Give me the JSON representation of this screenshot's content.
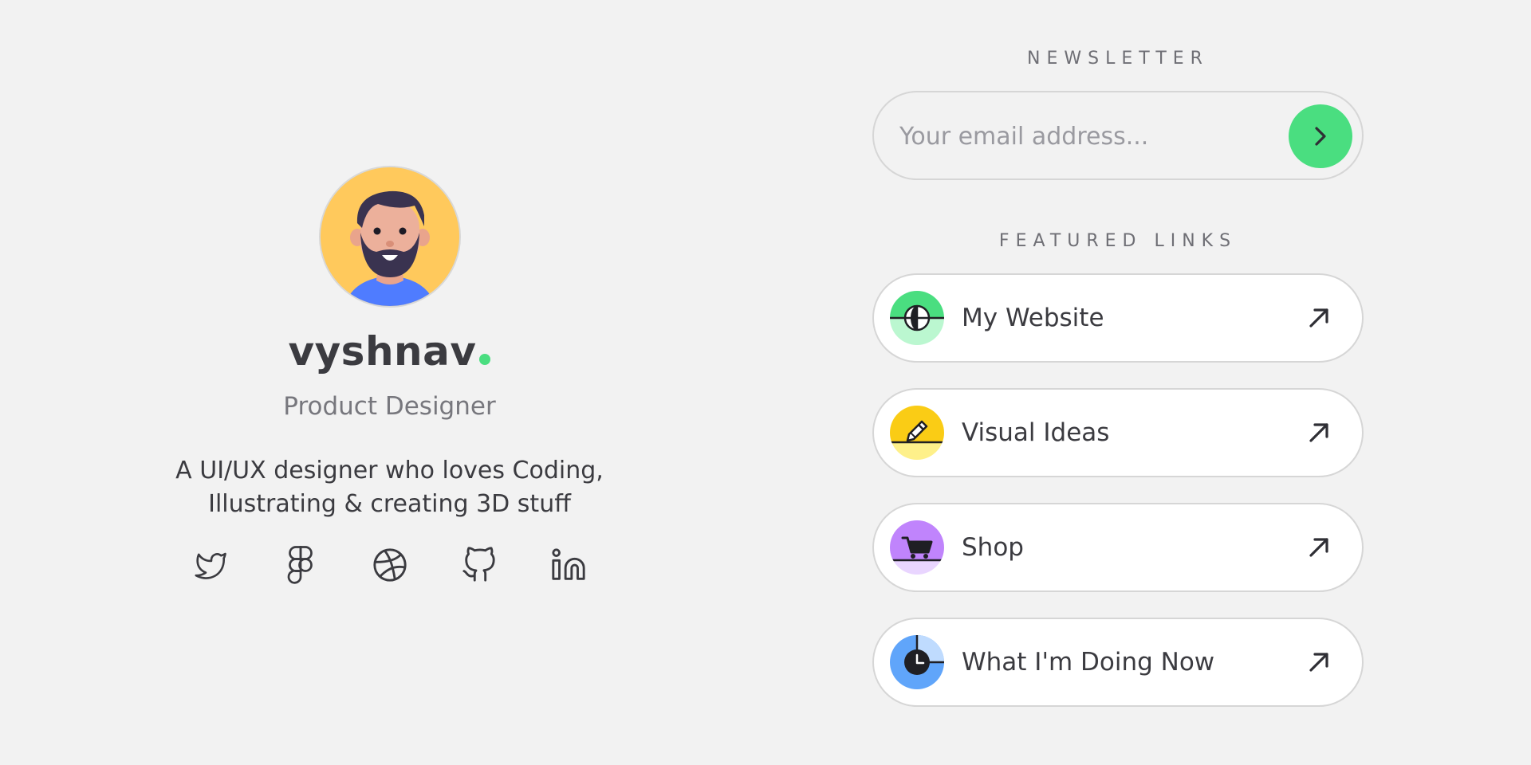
{
  "profile": {
    "name": "vyshnav",
    "role": "Product Designer",
    "bio_line1": "A UI/UX designer who loves Coding,",
    "bio_line2": "Illustrating & creating 3D stuff",
    "accent_color": "#4ade80",
    "social_links": [
      {
        "icon": "twitter-icon"
      },
      {
        "icon": "figma-icon"
      },
      {
        "icon": "dribbble-icon"
      },
      {
        "icon": "github-icon"
      },
      {
        "icon": "linkedin-icon"
      }
    ]
  },
  "newsletter": {
    "title": "NEWSLETTER",
    "placeholder": "Your email address...",
    "submit_icon": "chevron-right-icon",
    "button_color": "#4ade80"
  },
  "featured": {
    "title": "FEATURED LINKS",
    "links": [
      {
        "label": "My Website",
        "icon": "globe-icon",
        "color_top": "#4ade80",
        "color_bottom": "#bbf7d0"
      },
      {
        "label": "Visual Ideas",
        "icon": "pencil-icon",
        "color_top": "#facc15",
        "color_bottom": "#fef08a"
      },
      {
        "label": "Shop",
        "icon": "cart-icon",
        "color_top": "#c084fc",
        "color_bottom": "#e9d5ff"
      },
      {
        "label": "What I'm Doing Now",
        "icon": "clock-icon",
        "color_top": "#60a5fa",
        "color_bottom": "#bfdbfe"
      }
    ]
  }
}
